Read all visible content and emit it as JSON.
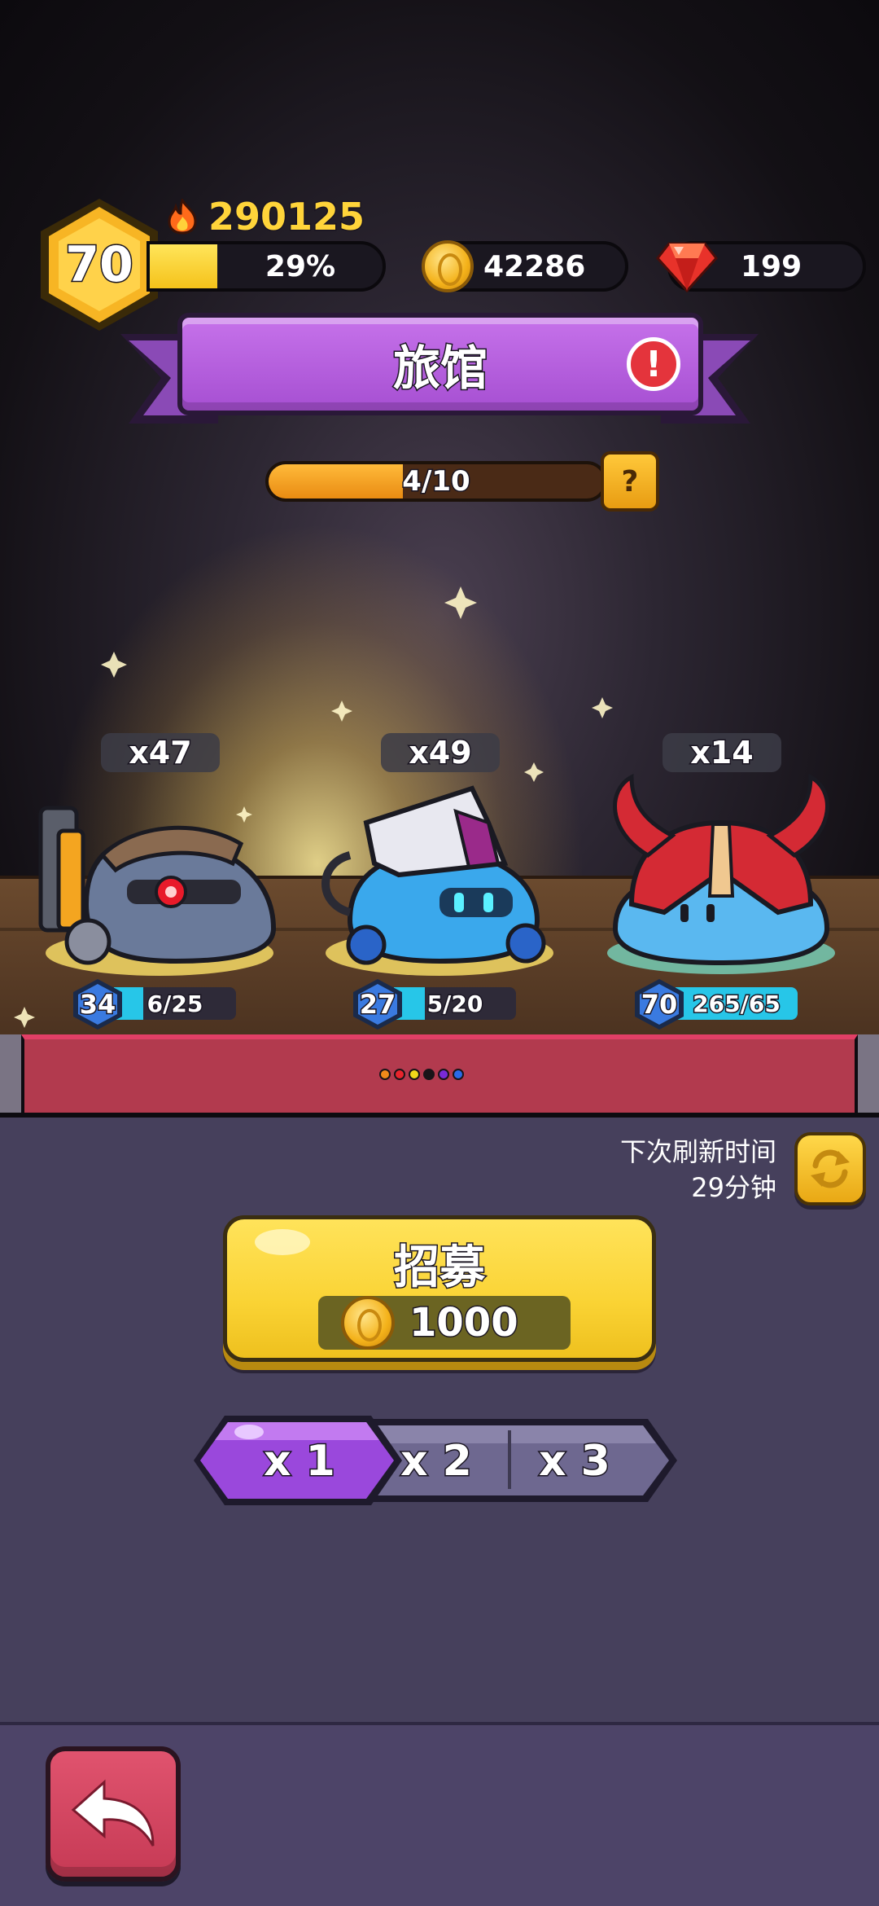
{
  "player": {
    "level": "70",
    "power": "290125",
    "xp_percent": "29%",
    "xp_fraction": 0.29
  },
  "currency": {
    "gold": "42286",
    "gems": "199"
  },
  "title": {
    "text": "旅馆",
    "alert": "!"
  },
  "progress": {
    "text": "4/10",
    "fraction": 0.4,
    "help": "?"
  },
  "heroes": [
    {
      "count": "x47",
      "level": "34",
      "shards": "6/25",
      "shard_fraction": 0.24
    },
    {
      "count": "x49",
      "level": "27",
      "shards": "5/20",
      "shard_fraction": 0.25
    },
    {
      "count": "x14",
      "level": "70",
      "shards": "265/65",
      "shard_fraction": 1.0
    }
  ],
  "page_dots": [
    "#f08a1a",
    "#e8242c",
    "#f2d81a",
    "#1a1418",
    "#7a2ad8",
    "#2a6ae8"
  ],
  "refresh": {
    "label": "下次刷新时间",
    "time": "29分钟"
  },
  "recruit": {
    "title": "招募",
    "cost": "1000"
  },
  "multiplier": {
    "options": [
      "x 1",
      "x 2",
      "x 3"
    ],
    "selected": 0
  },
  "colors": {
    "accent_purple": "#a64fd2",
    "recruit_yellow": "#fad334",
    "back_red": "#c63a55",
    "shard_cyan": "#27c6e8"
  },
  "icons": [
    "flame-icon",
    "coin-icon",
    "gem-icon",
    "alert-icon",
    "help-icon",
    "refresh-icon",
    "back-arrow-icon"
  ]
}
